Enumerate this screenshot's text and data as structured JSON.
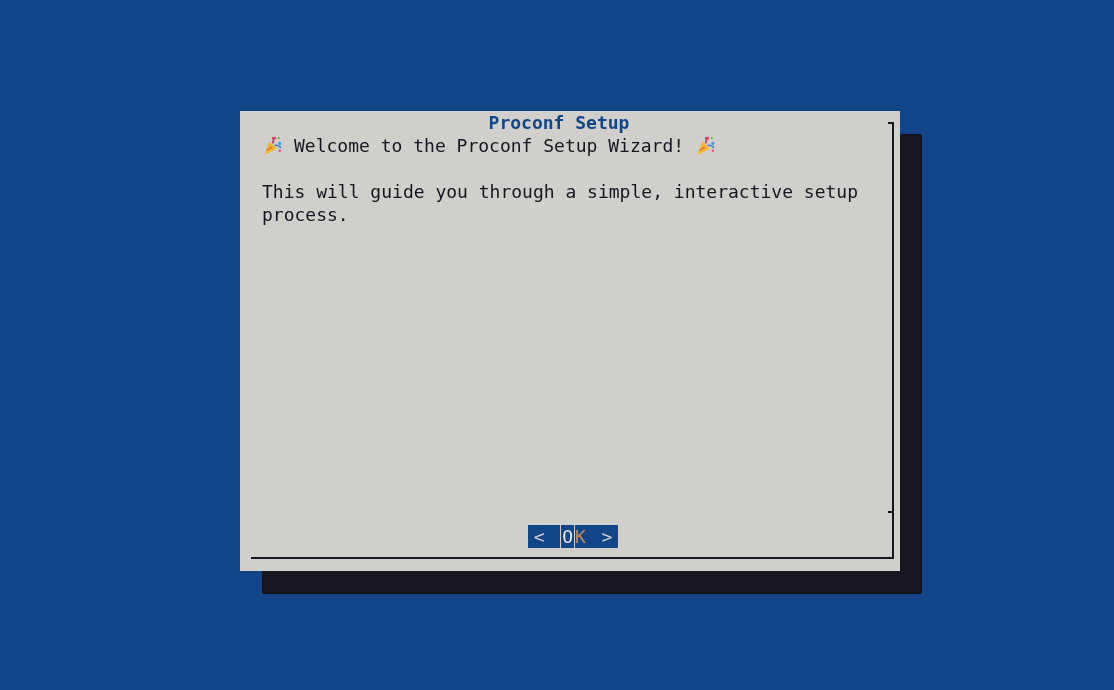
{
  "dialog": {
    "title": "Proconf Setup",
    "heading": "Welcome to the Proconf Setup Wizard!",
    "message": "This will guide you through a simple, interactive setup process.",
    "buttons": [
      {
        "left": "<",
        "label": "OK",
        "right": ">",
        "selected": true
      }
    ]
  }
}
